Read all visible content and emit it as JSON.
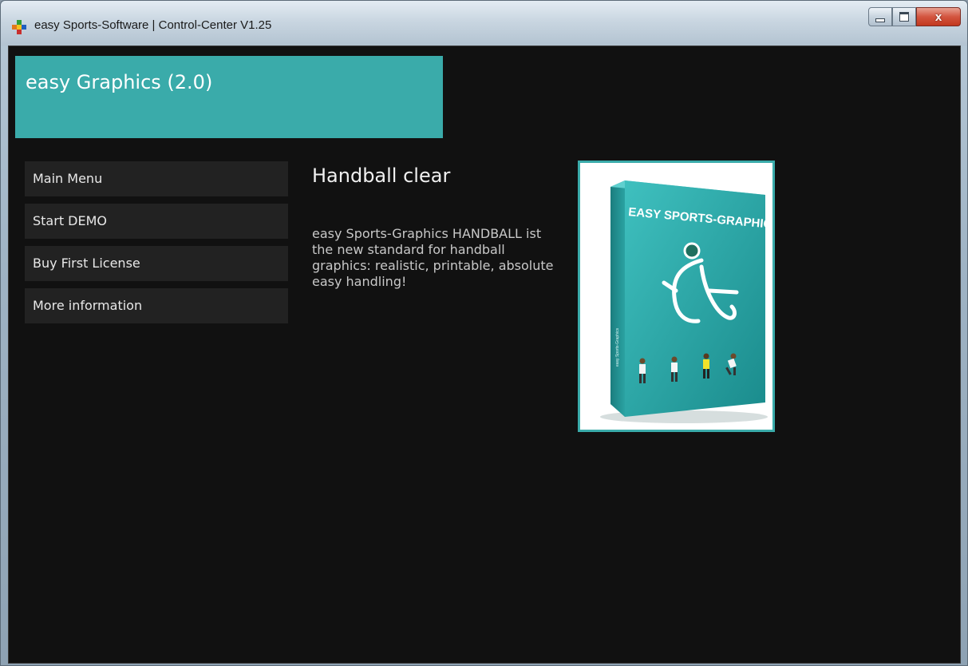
{
  "window": {
    "title": "easy Sports-Software | Control-Center V1.25",
    "close_glyph": "x",
    "icons": [
      "app-icon",
      "minimize-icon",
      "maximize-icon",
      "close-icon"
    ]
  },
  "header": {
    "title": "easy Graphics (2.0)"
  },
  "menu": {
    "items": [
      {
        "label": "Main Menu"
      },
      {
        "label": "Start DEMO"
      },
      {
        "label": "Buy First License"
      },
      {
        "label": "More information"
      }
    ]
  },
  "content": {
    "title": "Handball clear",
    "description": "easy Sports-Graphics HANDBALL ist the new standard for handball graphics: realistic, printable, absolute easy handling!"
  },
  "product": {
    "box_title": "EASY SPORTS-GRAPHICS",
    "box_side": "easy Sports-Graphics"
  },
  "colors": {
    "accent": "#3aabaa",
    "background": "#111111",
    "menu_item": "#222222"
  }
}
